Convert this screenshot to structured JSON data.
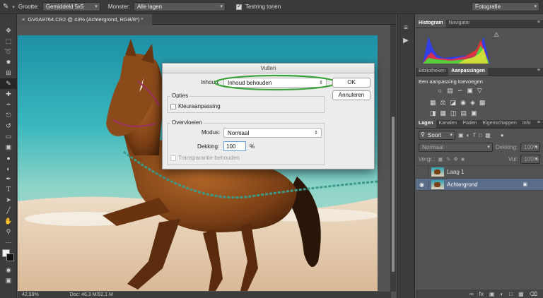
{
  "options_bar": {
    "sample_size_label": "Grootte:",
    "sample_size": "Gemiddeld 5x5",
    "sample_label": "Monster:",
    "sample": "Alle lagen",
    "ring_label": "Testring tonen",
    "workspace": "Fotografie"
  },
  "document": {
    "tab_title": "GV0A9764.CR2 @ 43% (Achtergrond, RGB/8*) *"
  },
  "status": {
    "zoom": "42,99%",
    "doc": "Doc: 46,3 M/92,1 M"
  },
  "histogram": {
    "tabs": [
      "Histogram",
      "Navigator"
    ]
  },
  "adjustments": {
    "tabs": [
      "Bibliotheken",
      "Aanpassingen"
    ],
    "heading": "Een aanpassing toevoegen"
  },
  "layers_panel": {
    "tabs": [
      "Lagen",
      "Kanalen",
      "Paden",
      "Eigenschappen",
      "Info"
    ],
    "filter": "Soort",
    "blend_mode": "Normaal",
    "opacity_label": "Dekking:",
    "opacity": "100%",
    "lock_label": "Vergr.:",
    "fill_label": "Vul:",
    "fill": "100%",
    "layers": [
      {
        "name": "Laag 1",
        "visible": false,
        "selected": false
      },
      {
        "name": "Achtergrond",
        "visible": true,
        "selected": true
      }
    ]
  },
  "dialog": {
    "title": "Vullen",
    "content_label": "Inhoud:",
    "content_value": "Inhoud behouden",
    "ok": "OK",
    "cancel": "Annuleren",
    "options_group": "Opties",
    "color_adapt": "Kleuraanpassing",
    "blend_group": "Overvloeien",
    "mode_label": "Modus:",
    "mode_value": "Normaal",
    "opacity_label": "Dekking:",
    "opacity_value": "100",
    "percent": "%",
    "preserve_transparency": "Transparantie behouden",
    "highlight_color": "#3aa43a"
  }
}
